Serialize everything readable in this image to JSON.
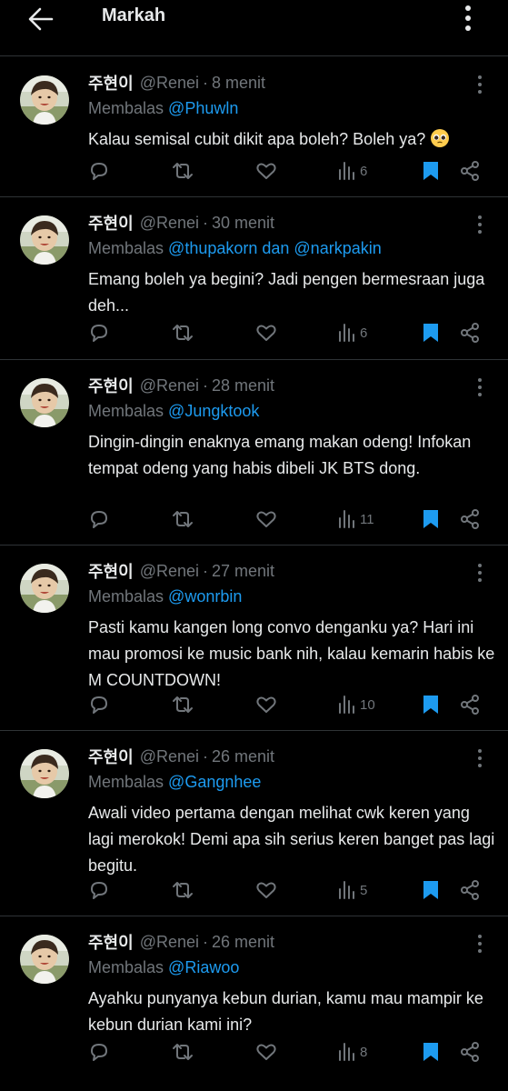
{
  "header": {
    "title": "Markah",
    "back_icon": "arrow-left-icon",
    "menu_icon": "more-vertical-icon"
  },
  "colors": {
    "background": "#000000",
    "text": "#e7e9ea",
    "muted": "#71767b",
    "accent": "#1d9bf0",
    "divider": "#2f3336"
  },
  "tweets": [
    {
      "name": "주현이",
      "handle": "@Renei",
      "time": "8 menit",
      "reply_prefix": "Membalas",
      "reply_to": "@Phuwln",
      "text": "Kalau semisal cubit dikit apa boleh? Boleh ya?",
      "emoji": "pleading-face-emoji",
      "views": "6"
    },
    {
      "name": "주현이",
      "handle": "@Renei",
      "time": "30 menit",
      "reply_prefix": "Membalas",
      "reply_to": "@thupakorn dan @narkpakin",
      "text": "Emang boleh ya begini? Jadi pengen bermesraan juga deh...",
      "views": "6"
    },
    {
      "name": "주현이",
      "handle": "@Renei",
      "time": "28 menit",
      "reply_prefix": "Membalas",
      "reply_to": "@Jungktook",
      "text": "Dingin-dingin enaknya emang makan odeng! Infokan tempat odeng yang habis dibeli JK BTS dong.",
      "views": "11"
    },
    {
      "name": "주현이",
      "handle": "@Renei",
      "time": "27 menit",
      "reply_prefix": "Membalas",
      "reply_to": "@wonrbin",
      "text": "Pasti kamu kangen long convo denganku ya? Hari ini mau promosi ke music bank nih, kalau kemarin habis ke M COUNTDOWN!",
      "views": "10"
    },
    {
      "name": "주현이",
      "handle": "@Renei",
      "time": "26 menit",
      "reply_prefix": "Membalas",
      "reply_to": "@Gangnhee",
      "text": "Awali video pertama dengan melihat cwk keren yang lagi merokok! Demi apa sih serius keren banget pas lagi begitu.",
      "views": "5"
    },
    {
      "name": "주현이",
      "handle": "@Renei",
      "time": "26 menit",
      "reply_prefix": "Membalas",
      "reply_to": "@Riawoo",
      "text": "Ayahku punyanya kebun durian, kamu mau mampir ke kebun durian kami ini?",
      "views": "8"
    }
  ]
}
